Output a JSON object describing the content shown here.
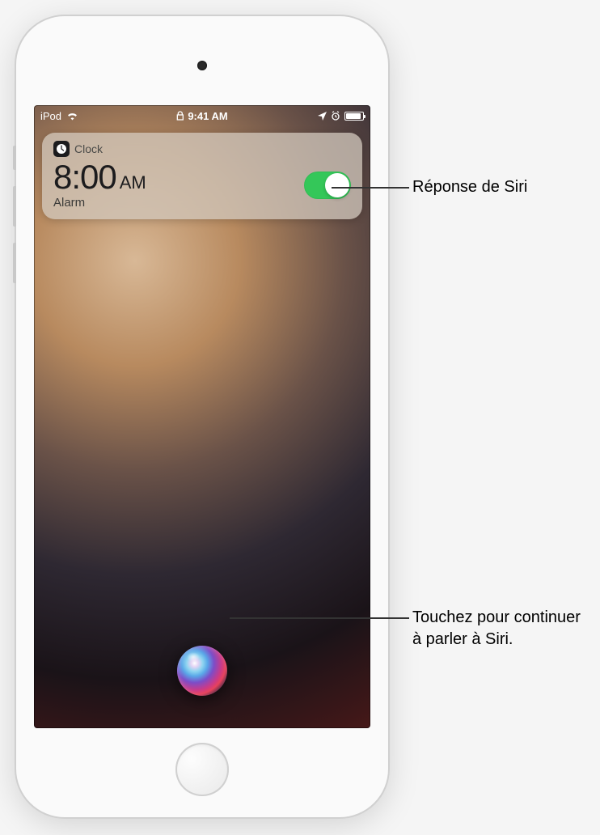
{
  "statusBar": {
    "carrier": "iPod",
    "time": "9:41 AM"
  },
  "notification": {
    "appName": "Clock",
    "timeValue": "8:00",
    "ampm": "AM",
    "subLabel": "Alarm",
    "toggleOn": true
  },
  "callouts": {
    "siriResponse": "Réponse de Siri",
    "tapToContinue": "Touchez pour continuer à parler à Siri."
  },
  "icons": {
    "wifi": "wifi-icon",
    "lock": "lock-icon",
    "location": "location-icon",
    "alarmStatus": "alarm-status-icon",
    "battery": "battery-icon",
    "clockApp": "clock-app-icon",
    "siri": "siri-orb-icon"
  }
}
